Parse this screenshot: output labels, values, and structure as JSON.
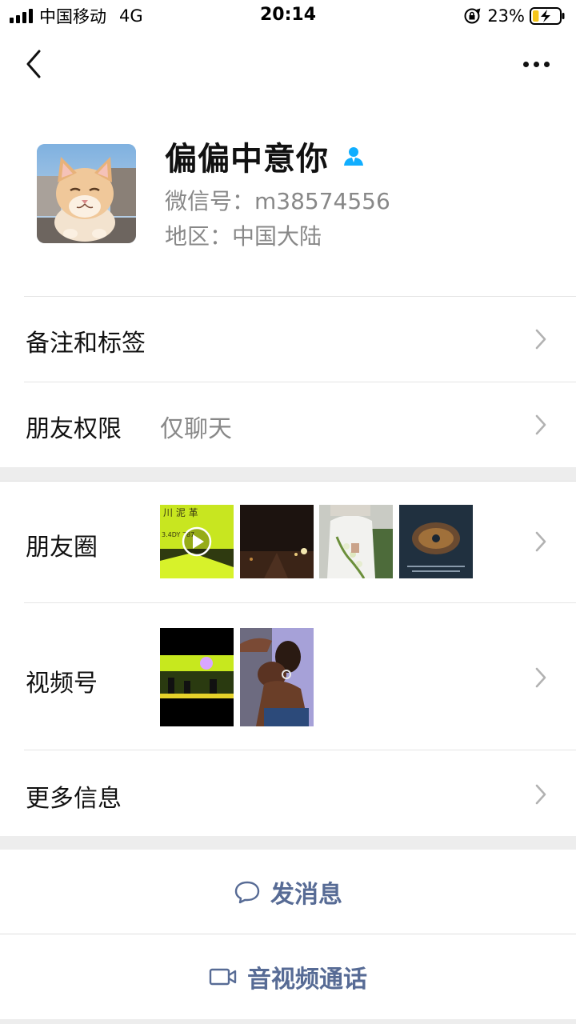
{
  "status_bar": {
    "carrier": "中国移动",
    "network": "4G",
    "time": "20:14",
    "battery_percent": "23%",
    "battery_level": 0.23,
    "charging": true
  },
  "nav": {
    "back_icon": "chevron-left-icon",
    "more_icon": "more-dots-icon"
  },
  "profile": {
    "nickname": "偏偏中意你",
    "wechat_id": "微信号：m38574556",
    "region": "地区：中国大陆",
    "avatar": "cat-avatar",
    "contact_icon_color": "#10aeff"
  },
  "rows": {
    "remarks_tags": {
      "label": "备注和标签"
    },
    "friend_permissions": {
      "label": "朋友权限",
      "value": "仅聊天"
    },
    "moments": {
      "label": "朋友圈"
    },
    "channels": {
      "label": "视频号"
    },
    "more_info": {
      "label": "更多信息"
    }
  },
  "actions": {
    "send_message": {
      "label": "发消息",
      "icon": "chat-bubble-icon"
    },
    "av_call": {
      "label": "音视频通话",
      "icon": "video-camera-icon"
    }
  },
  "colors": {
    "accent_link": "#576b95",
    "background": "#ededed",
    "secondary_text": "#888888"
  }
}
